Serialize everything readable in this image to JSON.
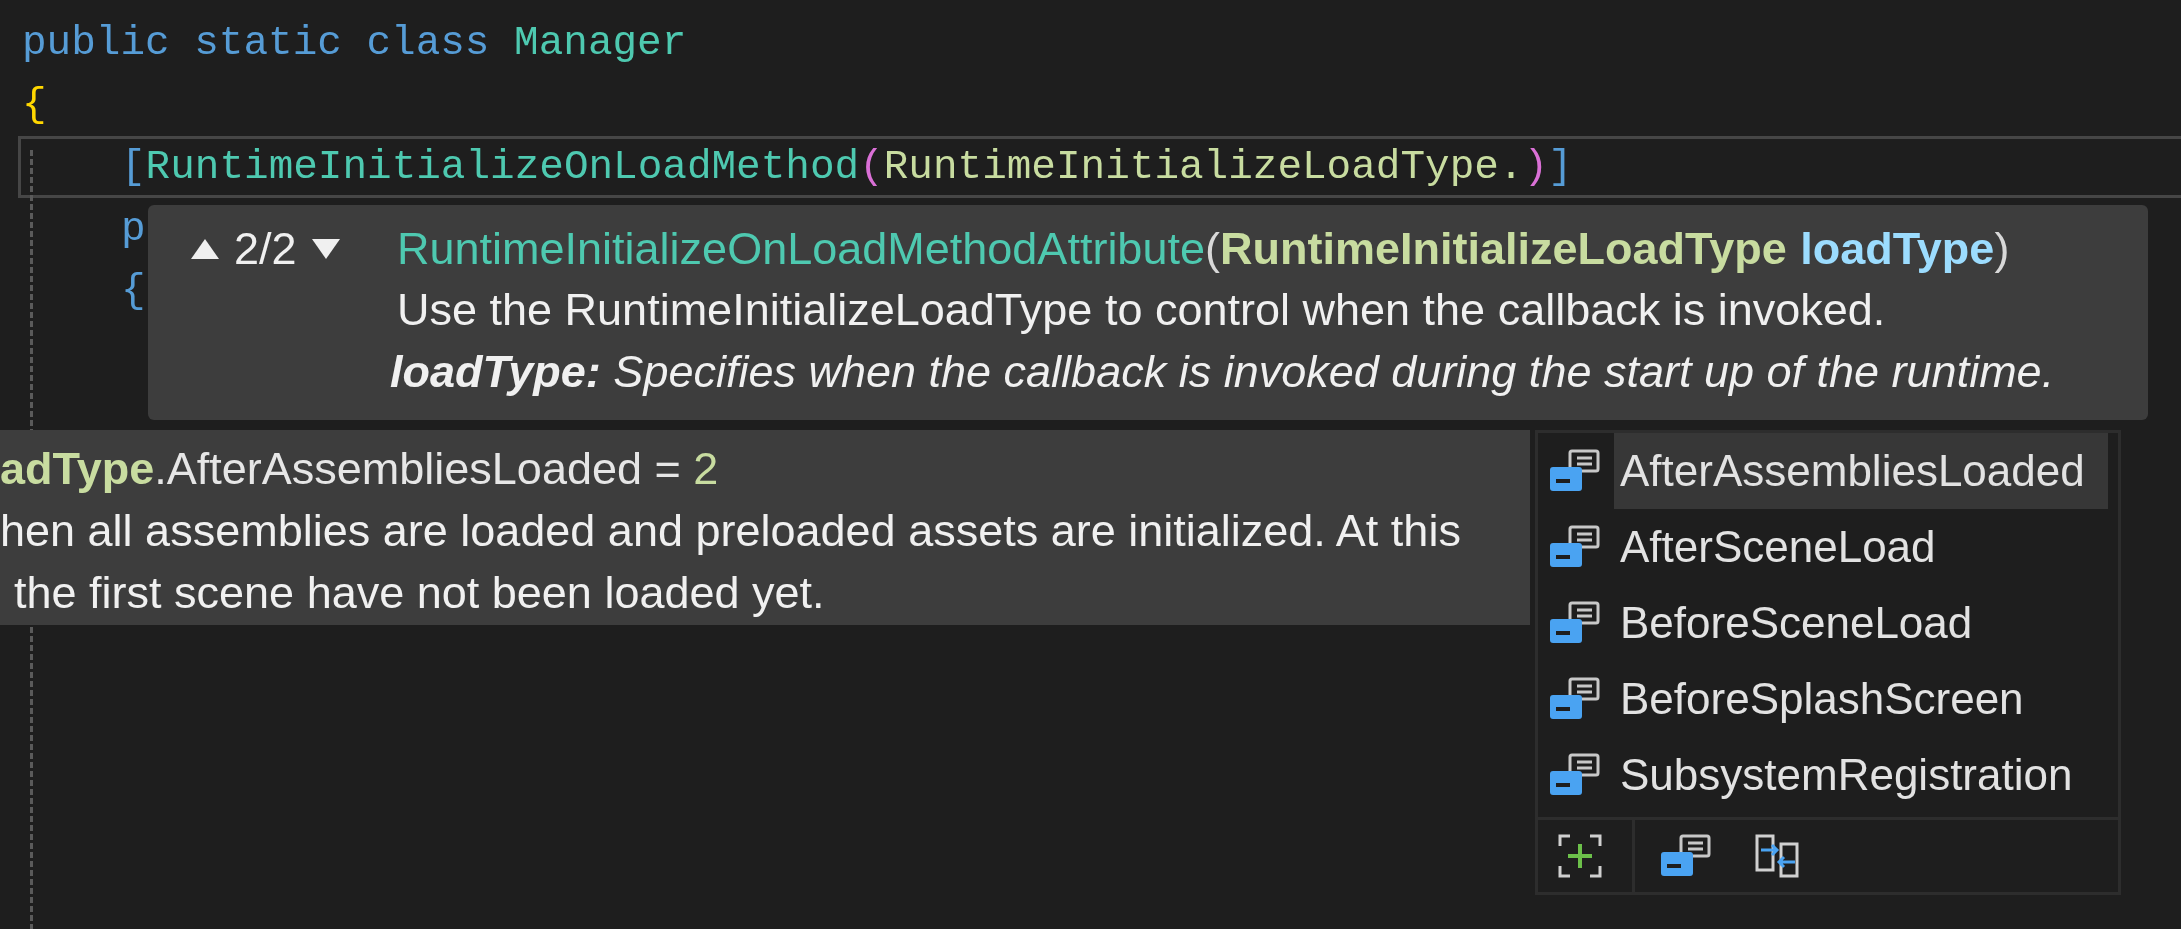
{
  "editor": {
    "lines": [
      {
        "current": false,
        "tokens": [
          {
            "text": "public static class ",
            "kind": "keyword"
          },
          {
            "text": "Manager",
            "kind": "type"
          }
        ]
      },
      {
        "current": false,
        "tokens": [
          {
            "text": "{",
            "kind": "brace"
          }
        ],
        "children": [
          {
            "current": true,
            "tokens": [
              {
                "text": "[",
                "kind": "bracket"
              },
              {
                "text": "RuntimeInitializeOnLoadMethod",
                "kind": "type"
              },
              {
                "text": "(",
                "kind": "paren"
              },
              {
                "text": "RuntimeInitializeLoadType.",
                "kind": "enum"
              },
              {
                "text": ")",
                "kind": "paren"
              },
              {
                "text": "]",
                "kind": "bracket"
              }
            ]
          },
          {
            "current": false,
            "tokens": [
              {
                "text": "p",
                "kind": "keyword"
              }
            ]
          },
          {
            "current": false,
            "tokens": [
              {
                "text": "{",
                "kind": "bracket"
              }
            ]
          }
        ]
      }
    ]
  },
  "signature_help": {
    "counter": "2/2",
    "signature": [
      {
        "text": "RuntimeInitializeOnLoadMethodAttribute",
        "kind": "method"
      },
      {
        "text": "(",
        "kind": "punct"
      },
      {
        "text": "RuntimeInitializeLoadType",
        "kind": "type"
      },
      {
        "text": "loadType",
        "kind": "param"
      },
      {
        "text": ")",
        "kind": "punct"
      }
    ],
    "description": "Use the RuntimeInitializeLoadType to control when the callback is invoked.",
    "parameter_doc": "**loadType:** Specifies when the callback is invoked during the start up of the runtime."
  },
  "quick_info": {
    "signature": [
      {
        "text": "adType",
        "kind": "type"
      },
      {
        "text": ".AfterAssembliesLoaded = ",
        "kind": "plain"
      },
      {
        "text": "2",
        "kind": "number"
      }
    ],
    "lines": [
      "hen all assemblies are loaded and preloaded assets are initialized. At this",
      "the first scene have not been loaded yet."
    ]
  },
  "completion": {
    "items": [
      {
        "label": "AfterAssembliesLoaded",
        "selected": true
      },
      {
        "label": "AfterSceneLoad",
        "selected": false
      },
      {
        "label": "BeforeSceneLoad",
        "selected": false
      },
      {
        "label": "BeforeSplashScreen",
        "selected": false
      },
      {
        "label": "SubsystemRegistration",
        "selected": false
      }
    ],
    "toolbar": [
      {
        "kind": "snippets"
      },
      {
        "kind": "enum"
      },
      {
        "kind": "expand"
      }
    ]
  }
}
